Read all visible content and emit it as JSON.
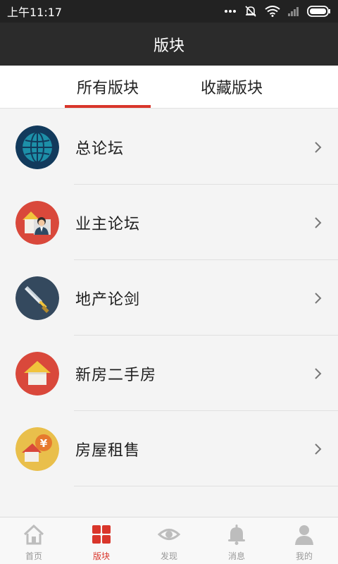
{
  "status_bar": {
    "time": "上午11:17"
  },
  "header": {
    "title": "版块"
  },
  "tabs": [
    {
      "label": "所有版块",
      "active": true
    },
    {
      "label": "收藏版块",
      "active": false
    }
  ],
  "forums": [
    {
      "label": "总论坛",
      "icon": "globe-icon"
    },
    {
      "label": "业主论坛",
      "icon": "house-owner-icon"
    },
    {
      "label": "地产论剑",
      "icon": "sword-icon"
    },
    {
      "label": "新房二手房",
      "icon": "house-icon"
    },
    {
      "label": "房屋租售",
      "icon": "house-yen-icon"
    }
  ],
  "bottom_nav": [
    {
      "label": "首页",
      "icon": "home-icon",
      "active": false
    },
    {
      "label": "版块",
      "icon": "grid-icon",
      "active": true
    },
    {
      "label": "发现",
      "icon": "eye-icon",
      "active": false
    },
    {
      "label": "消息",
      "icon": "bell-icon",
      "active": false
    },
    {
      "label": "我的",
      "icon": "person-icon",
      "active": false
    }
  ],
  "colors": {
    "accent": "#d9362b",
    "header_bg": "#2b2b2b",
    "status_bg": "#222222"
  }
}
